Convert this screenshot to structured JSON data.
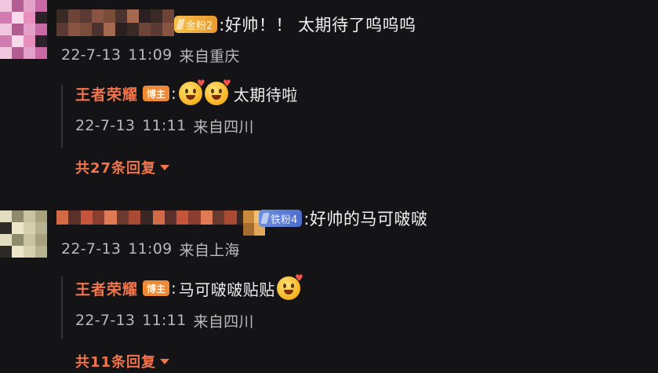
{
  "comments": [
    {
      "badge": "金粉2",
      "text": ":好帅！！ 太期待了呜呜呜",
      "date": "22-7-13",
      "time": "11:09",
      "location": "来自重庆",
      "reply": {
        "author": "王者荣耀",
        "author_badge": "博主",
        "colon": ":",
        "emojis": [
          "heart-face-emoji",
          "heart-face-emoji"
        ],
        "text": "太期待啦",
        "date": "22-7-13",
        "time": "11:11",
        "location": "来自四川"
      },
      "more_replies": "共27条回复"
    },
    {
      "badge": "铁粉4",
      "text": ":好帅的马可啵啵",
      "date": "22-7-13",
      "time": "11:09",
      "location": "来自上海",
      "reply": {
        "author": "王者荣耀",
        "author_badge": "博主",
        "colon": ":",
        "text": "马可啵啵贴贴",
        "emojis": [
          "heart-face-emoji"
        ],
        "date": "22-7-13",
        "time": "11:11",
        "location": "来自四川"
      },
      "more_replies": "共11条回复"
    }
  ],
  "colors": {
    "background": "#141416",
    "accent": "#f0744c",
    "meta_text": "#b9b9bd",
    "gold_badge": "#f6c04a",
    "iron_badge": "#6d8fe0",
    "author_badge": "#ee8a35"
  }
}
